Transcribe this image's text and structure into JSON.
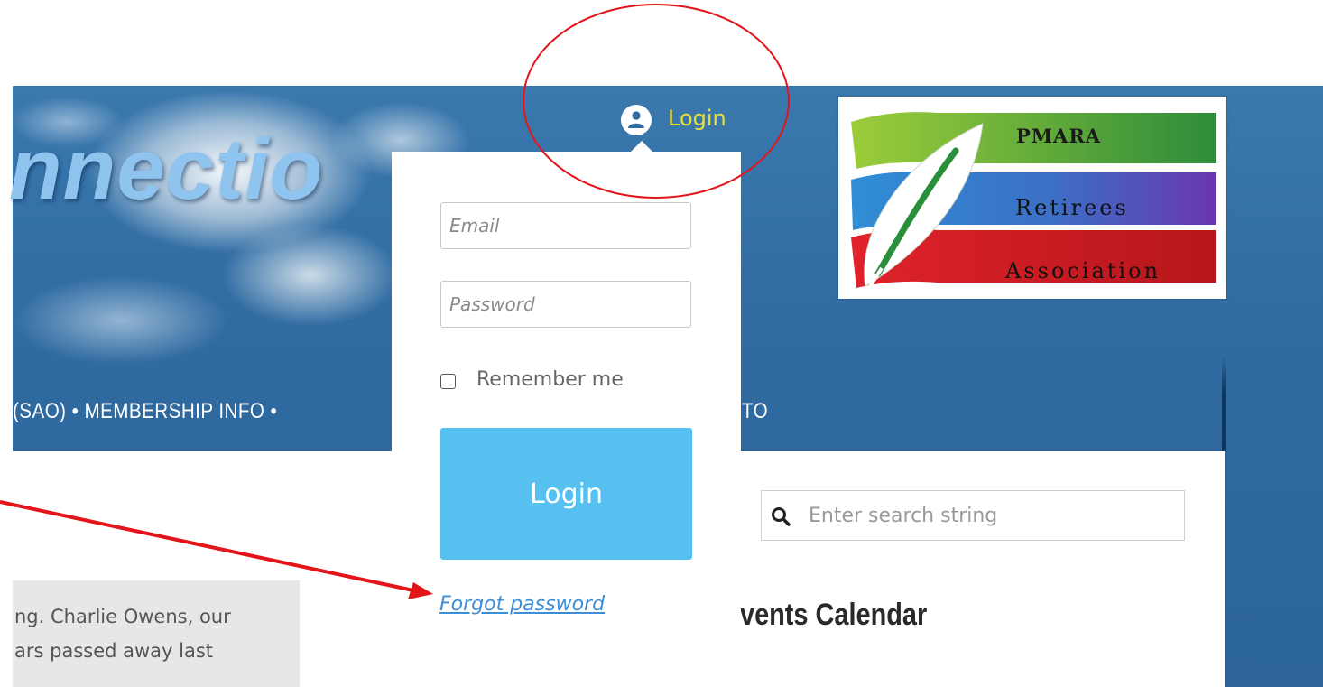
{
  "header": {
    "site_title": "nnectio",
    "login_label": "Login"
  },
  "nav": {
    "left_text": "(SAO)  •  MEMBERSHIP INFO  •",
    "right_text": "TO"
  },
  "logo": {
    "line1": "PMARA",
    "line2": "Retirees",
    "line3": "Association"
  },
  "login_form": {
    "email_placeholder": "Email",
    "password_placeholder": "Password",
    "remember_label": "Remember me",
    "submit_label": "Login",
    "forgot_label": "Forgot password"
  },
  "search": {
    "placeholder": "Enter search string"
  },
  "events": {
    "heading": "vents Calendar"
  },
  "news": {
    "line1": "ng. Charlie Owens, our",
    "line2": "ars passed away last"
  },
  "colors": {
    "login_link": "#e6e03a",
    "login_button": "#56c0f0",
    "forgot_link": "#3c8fd6",
    "annotation": "#e3151a"
  }
}
